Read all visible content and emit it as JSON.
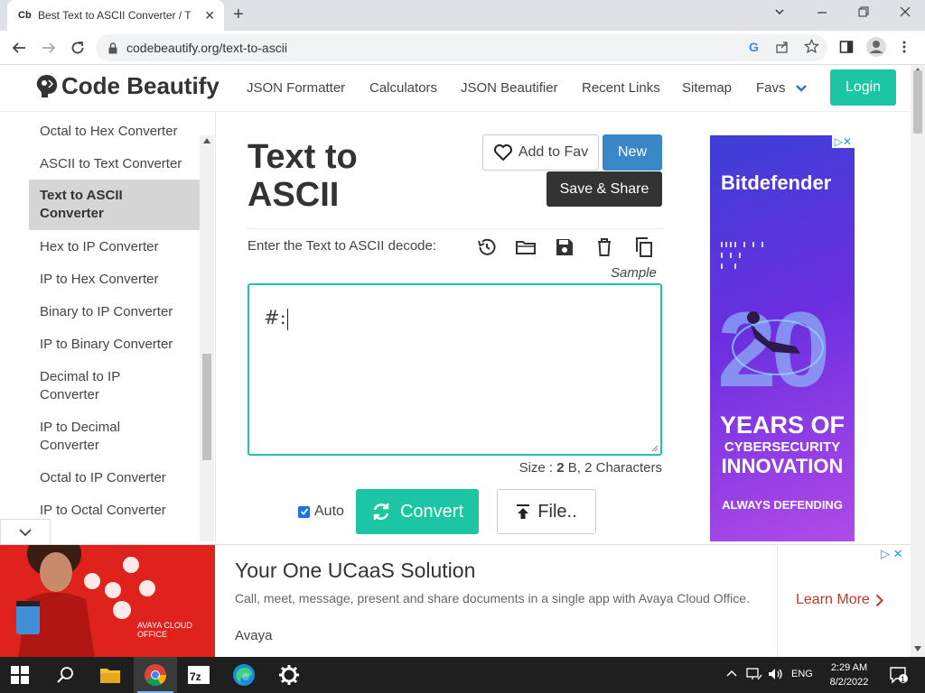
{
  "browser": {
    "tab_favicon": "Cb",
    "tab_title": "Best Text to ASCII Converter / Tra",
    "url": "codebeautify.org/text-to-ascii"
  },
  "header": {
    "logo": "Code Beautify",
    "nav": [
      "JSON Formatter",
      "Calculators",
      "JSON Beautifier",
      "Recent Links",
      "Sitemap",
      "Favs"
    ],
    "login": "Login"
  },
  "sidebar": {
    "items": [
      {
        "label": "Octal to Hex Converter"
      },
      {
        "label": "ASCII to Text Converter"
      },
      {
        "label": "Text to ASCII Converter"
      },
      {
        "label": "Hex to IP Converter"
      },
      {
        "label": "IP to Hex Converter"
      },
      {
        "label": "Binary to IP Converter"
      },
      {
        "label": "IP to Binary Converter"
      },
      {
        "label": "Decimal to IP Converter"
      },
      {
        "label": "IP to Decimal Converter"
      },
      {
        "label": "Octal to IP Converter"
      },
      {
        "label": "IP to Octal Converter"
      }
    ],
    "active_index": 2
  },
  "main": {
    "title": "Text to ASCII",
    "add_fav": "Add to Fav",
    "new": "New",
    "save_share": "Save & Share",
    "input_label": "Enter the Text to ASCII decode:",
    "tools": [
      "history-icon",
      "folder-icon",
      "save-icon",
      "trash-icon",
      "copy-icon"
    ],
    "sample": "Sample",
    "input_value": "#:",
    "size_prefix": "Size : ",
    "size_value": "2",
    "size_suffix": " B, 2 Characters",
    "auto_label": "Auto",
    "auto_checked": true,
    "convert": "Convert",
    "file": "File.."
  },
  "right_ad": {
    "brand": "Bitdefender",
    "number": "20",
    "line1": "YEARS OF",
    "line2": "CYBERSECURITY",
    "line3": "INNOVATION",
    "line4": "ALWAYS DEFENDING"
  },
  "bottom_ad": {
    "headline": "Your One UCaaS Solution",
    "body": "Call, meet, message, present and share documents in a single app with Avaya Cloud Office.",
    "sponsor": "Avaya",
    "cta": "Learn More",
    "image_text": "AVAYA CLOUD OFFICE"
  },
  "taskbar": {
    "time": "2:29 AM",
    "date": "8/2/2022",
    "lang": "ENG",
    "notification_count": "1"
  },
  "colors": {
    "accent": "#1cc6a4",
    "new_button": "#3a87c8",
    "share_button": "#333333",
    "ad_red": "#e0221c"
  }
}
